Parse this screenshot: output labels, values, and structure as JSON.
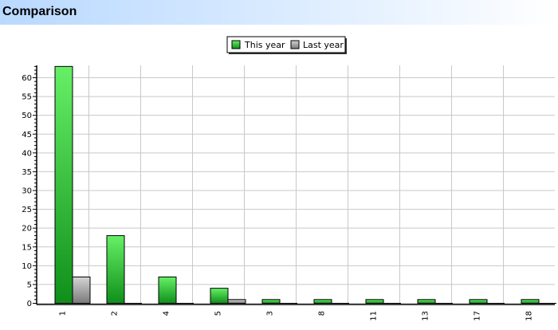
{
  "header": {
    "title": "Comparison"
  },
  "chart_data": {
    "type": "bar",
    "title": "",
    "xlabel": "",
    "ylabel": "",
    "categories": [
      "1",
      "2",
      "4",
      "5",
      "3",
      "8",
      "11",
      "13",
      "17",
      "18"
    ],
    "series": [
      {
        "name": "This year",
        "color": "#22b622",
        "values": [
          63,
          18,
          7,
          4,
          1,
          1,
          1,
          1,
          1,
          1
        ]
      },
      {
        "name": "Last year",
        "color": "#a0a0a0",
        "values": [
          7,
          0,
          0,
          1,
          0,
          0,
          0,
          0,
          0,
          0
        ]
      }
    ],
    "ylim": [
      0,
      65
    ],
    "yticks": [
      0,
      5,
      10,
      15,
      20,
      25,
      30,
      35,
      40,
      45,
      50,
      55,
      60
    ],
    "grid": true,
    "legend_position": "top-center"
  }
}
